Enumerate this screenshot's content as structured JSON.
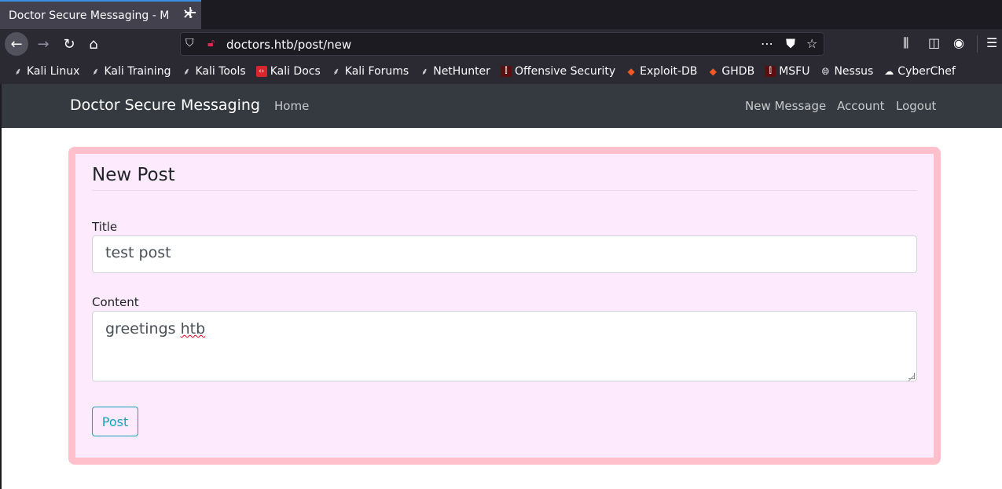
{
  "browser": {
    "tab_title": "Doctor Secure Messaging - M",
    "url": "doctors.htb/post/new",
    "bookmarks": [
      {
        "label": "Kali Linux",
        "icon": "kali-dragon-icon"
      },
      {
        "label": "Kali Training",
        "icon": "kali-dragon-icon"
      },
      {
        "label": "Kali Tools",
        "icon": "kali-dragon-icon"
      },
      {
        "label": "Kali Docs",
        "icon": "kali-docs-icon"
      },
      {
        "label": "Kali Forums",
        "icon": "kali-dragon-icon"
      },
      {
        "label": "NetHunter",
        "icon": "nethunter-icon"
      },
      {
        "label": "Offensive Security",
        "icon": "offsec-icon"
      },
      {
        "label": "Exploit-DB",
        "icon": "exploit-db-icon"
      },
      {
        "label": "GHDB",
        "icon": "ghdb-icon"
      },
      {
        "label": "MSFU",
        "icon": "msfu-icon"
      },
      {
        "label": "Nessus",
        "icon": "globe-icon"
      },
      {
        "label": "CyberChef",
        "icon": "cyberchef-icon"
      }
    ]
  },
  "site": {
    "brand": "Doctor Secure Messaging",
    "nav_left": [
      "Home"
    ],
    "nav_right": [
      "New Message",
      "Account",
      "Logout"
    ]
  },
  "form": {
    "legend": "New Post",
    "title_label": "Title",
    "title_value": "test post",
    "content_label": "Content",
    "content_value_word1": "greetings",
    "content_value_word2": "htb",
    "submit_label": "Post"
  },
  "colors": {
    "card_border": "#ffc0cb",
    "card_bg": "#fdeafd",
    "button_accent": "#17a2b8",
    "navbar_bg": "#343a40"
  }
}
